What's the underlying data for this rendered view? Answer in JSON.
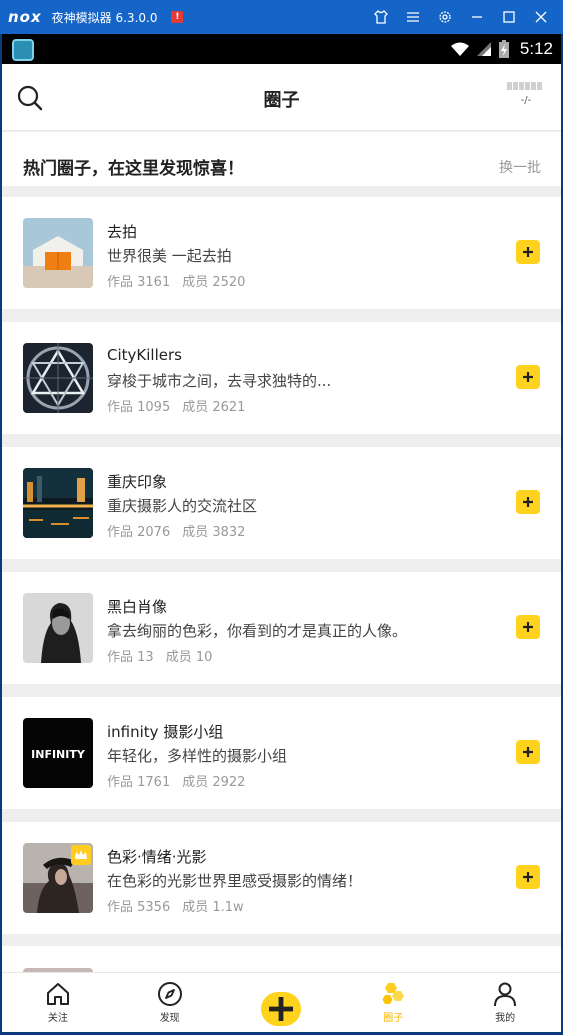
{
  "emulator": {
    "logo": "nox",
    "title": "夜神模拟器 6.3.0.0",
    "alert": "!"
  },
  "status_bar": {
    "time": "5:12"
  },
  "header": {
    "title": "圈子",
    "right_text": "-/-"
  },
  "hot": {
    "title": "热门圈子，在这里发现惊喜！",
    "refresh_label": "换一批"
  },
  "circles": [
    {
      "name": "去拍",
      "desc": "世界很美 一起去拍",
      "works": "作品 3161",
      "members": "成员 2520"
    },
    {
      "name": "CityKillers",
      "desc": "穿梭于城市之间，去寻求独特的...",
      "works": "作品 1095",
      "members": "成员 2621"
    },
    {
      "name": "重庆印象",
      "desc": "重庆摄影人的交流社区",
      "works": "作品 2076",
      "members": "成员 3832"
    },
    {
      "name": "黑白肖像",
      "desc": "拿去绚丽的色彩，你看到的才是真正的人像。",
      "works": "作品 13",
      "members": "成员 10"
    },
    {
      "name": "infinity 摄影小组",
      "desc": "年轻化，多样性的摄影小组",
      "works": "作品 1761",
      "members": "成员 2922",
      "thumb_text": "INFINITY"
    },
    {
      "name": "色彩·情绪·光影",
      "desc": "在色彩的光影世界里感受摄影的情绪！",
      "works": "作品 5356",
      "members": "成员 1.1w"
    }
  ],
  "nav": {
    "follow": "关注",
    "discover": "发现",
    "circle": "圈子",
    "mine": "我的"
  },
  "colors": {
    "accent": "#ffd21e",
    "active_nav": "#f7b500",
    "emulator_bar": "#1565c8"
  }
}
